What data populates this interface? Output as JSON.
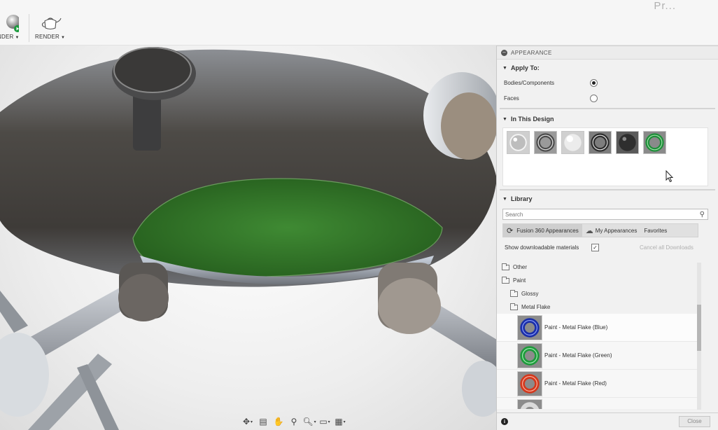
{
  "toolbar": {
    "left_label": "NDER",
    "render_label": "RENDER",
    "top_right_text": "Pr..."
  },
  "panel": {
    "title": "APPEARANCE",
    "apply_to": {
      "heading": "Apply To:",
      "options": [
        {
          "label": "Bodies/Components",
          "selected": true
        },
        {
          "label": "Faces",
          "selected": false
        }
      ]
    },
    "in_this_design": {
      "heading": "In This Design",
      "swatches": [
        {
          "name": "glass-clear-icon",
          "color": "#c9c9c9"
        },
        {
          "name": "metal-ring-gray-icon",
          "color": "#8a8a8a"
        },
        {
          "name": "white-sphere-icon",
          "color": "#e6e6e6"
        },
        {
          "name": "chrome-ring-icon",
          "color": "#6f6f6f"
        },
        {
          "name": "dark-sphere-icon",
          "color": "#3a3a3a"
        },
        {
          "name": "green-ring-icon",
          "color": "#1f8f3a"
        }
      ]
    },
    "library": {
      "heading": "Library",
      "search_placeholder": "Search",
      "tabs": [
        {
          "label": "Fusion 360 Appearances",
          "active": true
        },
        {
          "label": "My Appearances",
          "active": false
        },
        {
          "label": "Favorites",
          "active": false
        }
      ],
      "show_downloadable_label": "Show downloadable materials",
      "show_downloadable_checked": true,
      "cancel_downloads_label": "Cancel all Downloads",
      "tree": [
        {
          "label": "Other",
          "indent": 0
        },
        {
          "label": "Paint",
          "indent": 0
        },
        {
          "label": "Glossy",
          "indent": 1
        },
        {
          "label": "Metal Flake",
          "indent": 1
        }
      ],
      "materials": [
        {
          "label": "Paint - Metal Flake (Blue)",
          "color": "#1b2fa8"
        },
        {
          "label": "Paint - Metal Flake (Green)",
          "color": "#1f9a3c"
        },
        {
          "label": "Paint - Metal Flake (Red)",
          "color": "#d2391e"
        },
        {
          "label": "",
          "color": "#9a9a9a"
        }
      ]
    },
    "close_label": "Close",
    "info_symbol": "i"
  },
  "nav_bar": {
    "icons": [
      "orbit-icon",
      "look-at-icon",
      "pan-icon",
      "zoom-window-icon",
      "zoom-icon",
      "display-settings-icon",
      "grid-settings-icon"
    ]
  }
}
